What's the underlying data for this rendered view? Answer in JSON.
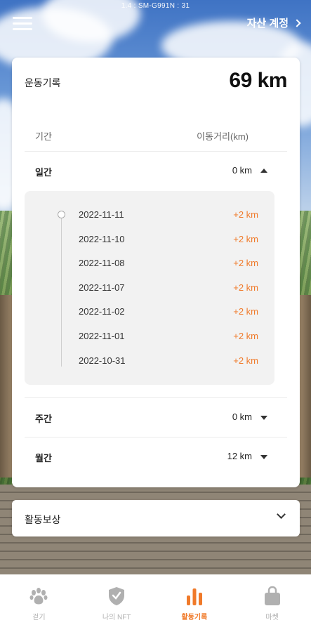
{
  "status_bar": {
    "text": "1.4 : SM-G991N : 31"
  },
  "header": {
    "asset_account_label": "자산 계정"
  },
  "activity_card": {
    "title": "운동기록",
    "total": "69 km",
    "column_period": "기간",
    "column_distance": "이동거리(km)",
    "daily": {
      "label": "일간",
      "value": "0 km",
      "expanded": true,
      "entries": [
        {
          "date": "2022-11-11",
          "km": "+2 km"
        },
        {
          "date": "2022-11-10",
          "km": "+2 km"
        },
        {
          "date": "2022-11-08",
          "km": "+2 km"
        },
        {
          "date": "2022-11-07",
          "km": "+2 km"
        },
        {
          "date": "2022-11-02",
          "km": "+2 km"
        },
        {
          "date": "2022-11-01",
          "km": "+2 km"
        },
        {
          "date": "2022-10-31",
          "km": "+2 km"
        }
      ]
    },
    "weekly": {
      "label": "주간",
      "value": "0 km"
    },
    "monthly": {
      "label": "월간",
      "value": "12 km"
    }
  },
  "reward": {
    "label": "활동보상"
  },
  "nav": {
    "items": [
      {
        "label": "걷기",
        "icon": "paw-icon"
      },
      {
        "label": "나의 NFT",
        "icon": "shield-nft-icon"
      },
      {
        "label": "활동기록",
        "icon": "bar-chart-icon",
        "active": true
      },
      {
        "label": "마켓",
        "icon": "shopping-bag-icon"
      }
    ]
  },
  "colors": {
    "accent": "#f07a2a",
    "inactive": "#b0b0b0"
  }
}
